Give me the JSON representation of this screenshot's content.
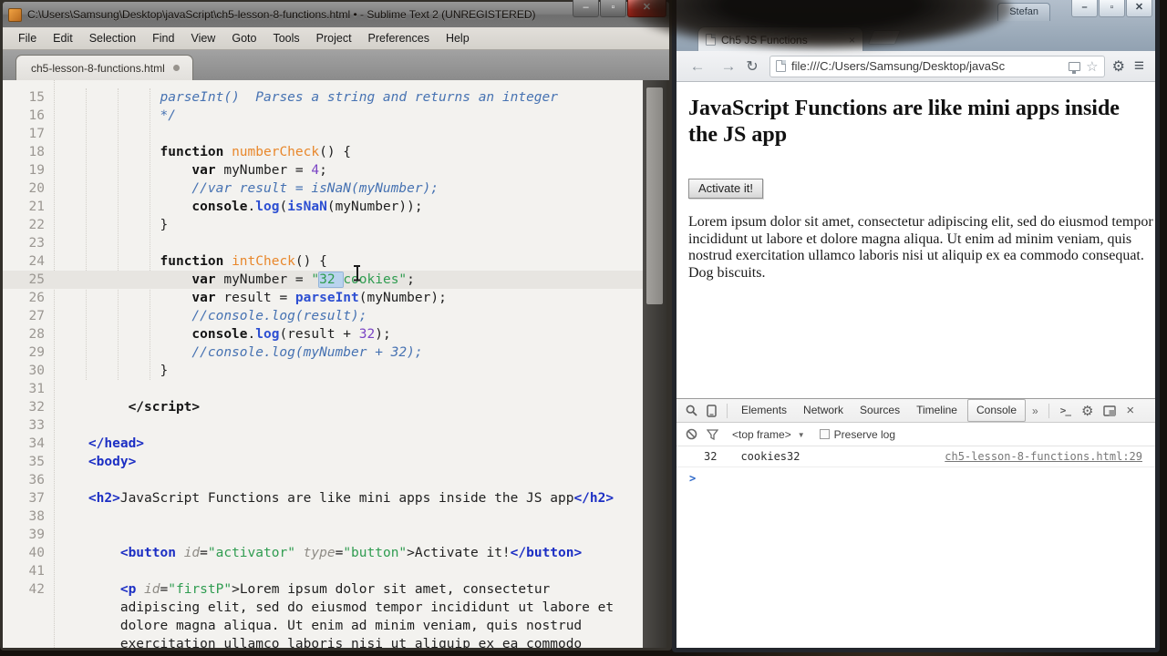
{
  "sublime": {
    "title": "C:\\Users\\Samsung\\Desktop\\javaScript\\ch5-lesson-8-functions.html • - Sublime Text 2 (UNREGISTERED)",
    "menu": [
      "File",
      "Edit",
      "Selection",
      "Find",
      "View",
      "Goto",
      "Tools",
      "Project",
      "Preferences",
      "Help"
    ],
    "tab_label": "ch5-lesson-8-functions.html",
    "window_buttons": {
      "minimize": "–",
      "maximize": "▫",
      "close": "✕"
    },
    "editor": {
      "lines": [
        {
          "n": "15",
          "segs": [
            [
              "pl",
              "             "
            ],
            [
              "cm",
              "parseInt()  Parses a string and returns an integer"
            ]
          ]
        },
        {
          "n": "16",
          "segs": [
            [
              "pl",
              "             "
            ],
            [
              "cm",
              "*/"
            ]
          ]
        },
        {
          "n": "17",
          "segs": []
        },
        {
          "n": "18",
          "segs": [
            [
              "pl",
              "             "
            ],
            [
              "kw",
              "function"
            ],
            [
              "pl",
              " "
            ],
            [
              "fn",
              "numberCheck"
            ],
            [
              "pl",
              "() {"
            ]
          ]
        },
        {
          "n": "19",
          "segs": [
            [
              "pl",
              "                 "
            ],
            [
              "kw",
              "var"
            ],
            [
              "pl",
              " myNumber = "
            ],
            [
              "nu",
              "4"
            ],
            [
              "pl",
              ";"
            ]
          ]
        },
        {
          "n": "20",
          "segs": [
            [
              "pl",
              "                 "
            ],
            [
              "cm",
              "//var result = isNaN(myNumber);"
            ]
          ]
        },
        {
          "n": "21",
          "segs": [
            [
              "pl",
              "                 "
            ],
            [
              "kw",
              "console"
            ],
            [
              "pl",
              "."
            ],
            [
              "bi",
              "log"
            ],
            [
              "pl",
              "("
            ],
            [
              "bi",
              "isNaN"
            ],
            [
              "pl",
              "(myNumber));"
            ]
          ]
        },
        {
          "n": "22",
          "segs": [
            [
              "pl",
              "             }"
            ]
          ]
        },
        {
          "n": "23",
          "segs": []
        },
        {
          "n": "24",
          "segs": [
            [
              "pl",
              "             "
            ],
            [
              "kw",
              "function"
            ],
            [
              "pl",
              " "
            ],
            [
              "fn",
              "intCheck"
            ],
            [
              "pl",
              "() {"
            ]
          ]
        },
        {
          "n": "25",
          "hl": true,
          "segs": [
            [
              "pl",
              "                 "
            ],
            [
              "kw",
              "var"
            ],
            [
              "pl",
              " myNumber = "
            ],
            [
              "st",
              "\""
            ],
            [
              "se",
              "32 "
            ],
            [
              "st",
              "cookies\""
            ],
            [
              "pl",
              ";"
            ]
          ]
        },
        {
          "n": "26",
          "segs": [
            [
              "pl",
              "                 "
            ],
            [
              "kw",
              "var"
            ],
            [
              "pl",
              " result = "
            ],
            [
              "bi",
              "parseInt"
            ],
            [
              "pl",
              "(myNumber);"
            ]
          ]
        },
        {
          "n": "27",
          "segs": [
            [
              "pl",
              "                 "
            ],
            [
              "cm",
              "//console.log(result);"
            ]
          ]
        },
        {
          "n": "28",
          "segs": [
            [
              "pl",
              "                 "
            ],
            [
              "kw",
              "console"
            ],
            [
              "pl",
              "."
            ],
            [
              "bi",
              "log"
            ],
            [
              "pl",
              "(result + "
            ],
            [
              "nu",
              "32"
            ],
            [
              "pl",
              ");"
            ]
          ]
        },
        {
          "n": "29",
          "segs": [
            [
              "pl",
              "                 "
            ],
            [
              "cm",
              "//console.log(myNumber + 32);"
            ]
          ]
        },
        {
          "n": "30",
          "segs": [
            [
              "pl",
              "             }"
            ]
          ]
        },
        {
          "n": "31",
          "segs": []
        },
        {
          "n": "32",
          "segs": [
            [
              "pl",
              "         "
            ],
            [
              "tk",
              "</script>"
            ]
          ]
        },
        {
          "n": "33",
          "segs": []
        },
        {
          "n": "34",
          "segs": [
            [
              "pl",
              "    "
            ],
            [
              "tg",
              "</head>"
            ]
          ]
        },
        {
          "n": "35",
          "segs": [
            [
              "pl",
              "    "
            ],
            [
              "tg",
              "<body>"
            ]
          ]
        },
        {
          "n": "36",
          "segs": []
        },
        {
          "n": "37",
          "segs": [
            [
              "pl",
              "    "
            ],
            [
              "tg",
              "<h2>"
            ],
            [
              "pl",
              "JavaScript Functions are like mini apps inside the JS app"
            ],
            [
              "tg",
              "</h2>"
            ]
          ]
        },
        {
          "n": "38",
          "segs": []
        },
        {
          "n": "39",
          "segs": []
        },
        {
          "n": "40",
          "segs": [
            [
              "pl",
              "        "
            ],
            [
              "tg",
              "<button"
            ],
            [
              "pl",
              " "
            ],
            [
              "at",
              "id"
            ],
            [
              "pl",
              "="
            ],
            [
              "st",
              "\"activator\""
            ],
            [
              "pl",
              " "
            ],
            [
              "at",
              "type"
            ],
            [
              "pl",
              "="
            ],
            [
              "st",
              "\"button\""
            ],
            [
              "pl",
              ">"
            ],
            [
              "pl",
              "Activate it!"
            ],
            [
              "tg",
              "</button>"
            ]
          ]
        },
        {
          "n": "41",
          "segs": []
        },
        {
          "n": "42",
          "segs": [
            [
              "pl",
              "        "
            ],
            [
              "tg",
              "<p"
            ],
            [
              "pl",
              " "
            ],
            [
              "at",
              "id"
            ],
            [
              "pl",
              "="
            ],
            [
              "st",
              "\"firstP\""
            ],
            [
              "pl",
              ">"
            ],
            [
              "pl",
              "Lorem ipsum dolor sit amet, consectetur"
            ]
          ]
        },
        {
          "n": "",
          "segs": [
            [
              "pl",
              "        adipiscing elit, sed do eiusmod tempor incididunt ut labore et"
            ]
          ]
        },
        {
          "n": "",
          "segs": [
            [
              "pl",
              "        dolore magna aliqua. Ut enim ad minim veniam, quis nostrud"
            ]
          ]
        },
        {
          "n": "",
          "segs": [
            [
              "pl",
              "        exercitation ullamco laboris nisi ut aliquip ex ea commodo"
            ]
          ]
        }
      ]
    }
  },
  "chrome": {
    "profile": "Stefan",
    "window_buttons": {
      "minimize": "–",
      "maximize": "▫",
      "close": "✕"
    },
    "tab_title": "Ch5 JS Functions",
    "tab_close": "×",
    "nav": {
      "back": "←",
      "forward": "→",
      "reload": "↻",
      "star": "☆",
      "gear": "⚙",
      "menu": "≡"
    },
    "url": "file:///C:/Users/Samsung/Desktop/javaSc",
    "page": {
      "heading": "JavaScript Functions are like mini apps inside the JS app",
      "button_label": "Activate it!",
      "paragraph": "Lorem ipsum dolor sit amet, consectetur adipiscing elit, sed do eiusmod tempor incididunt ut labore et dolore magna aliqua. Ut enim ad minim veniam, quis nostrud exercitation ullamco laboris nisi ut aliquip ex ea commodo consequat. Dog biscuits."
    },
    "devtools": {
      "tabs": [
        "Elements",
        "Network",
        "Sources",
        "Timeline",
        "Console"
      ],
      "selected_tab": "Console",
      "overflow": "»",
      "console_drawer": ">_",
      "gear": "⚙",
      "close": "×",
      "frame_select": "<top frame>",
      "drop_arrow": "▼",
      "preserve_log": "Preserve log",
      "log": {
        "value1": "32",
        "value2": "cookies32",
        "source": "ch5-lesson-8-functions.html:29"
      },
      "prompt": ">"
    }
  }
}
